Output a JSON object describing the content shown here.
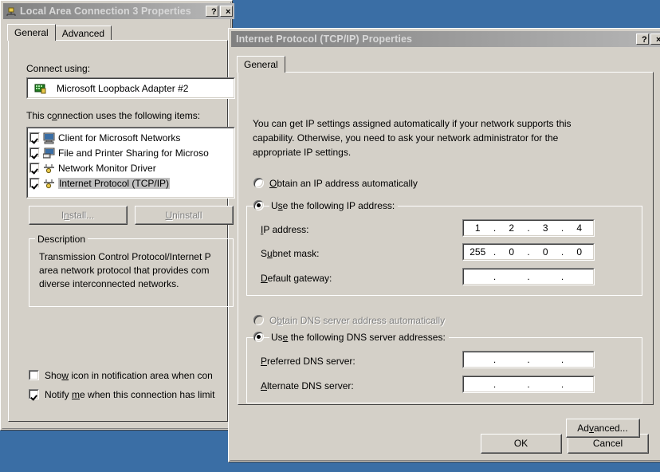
{
  "desktop": {
    "background_color": "#3a6ea5"
  },
  "back_dialog": {
    "title": "Local Area Connection 3 Properties",
    "icon": "network-connection-icon",
    "help_button": "?",
    "close_button": "×",
    "tabs": [
      {
        "label": "General",
        "active": true
      },
      {
        "label": "Advanced",
        "active": false
      }
    ],
    "connect_using_label": "Connect using:",
    "adapter": {
      "name": "Microsoft Loopback Adapter #2",
      "icon": "network-adapter-icon"
    },
    "items_label": "This connection uses the following items:",
    "items": [
      {
        "label": "Client for Microsoft Networks",
        "checked": true,
        "icon": "client-service-icon",
        "selected": false
      },
      {
        "label": "File and Printer Sharing for Microso",
        "checked": true,
        "icon": "file-sharing-icon",
        "selected": false
      },
      {
        "label": "Network Monitor Driver",
        "checked": true,
        "icon": "protocol-icon",
        "selected": false
      },
      {
        "label": "Internet Protocol (TCP/IP)",
        "checked": true,
        "icon": "protocol-icon",
        "selected": true
      }
    ],
    "install_button": "Install...",
    "uninstall_button": "Uninstall",
    "install_enabled": false,
    "uninstall_enabled": false,
    "description_group": "Description",
    "description_lines": [
      "Transmission Control Protocol/Internet P",
      "area network protocol that provides com",
      "diverse interconnected networks."
    ],
    "show_icon_checkbox": {
      "label": "Show icon in notification area when con",
      "checked": false
    },
    "notify_checkbox": {
      "label": "Notify me when this connection has limit",
      "checked": true
    }
  },
  "front_dialog": {
    "title": "Internet Protocol (TCP/IP) Properties",
    "help_button": "?",
    "close_button": "×",
    "tabs": [
      {
        "label": "General",
        "active": true
      }
    ],
    "intro_lines": [
      "You can get IP settings assigned automatically if your network supports this",
      "capability. Otherwise, you need to ask your network administrator for the",
      "appropriate IP settings."
    ],
    "ip_auto_radio": {
      "label": "Obtain an IP address automatically",
      "selected": false,
      "enabled": true
    },
    "ip_manual_radio": {
      "label": "Use the following IP address:",
      "selected": true,
      "enabled": true
    },
    "ip_address": {
      "label": "IP address:",
      "octets": [
        "1",
        "2",
        "3",
        "4"
      ]
    },
    "subnet_mask": {
      "label": "Subnet mask:",
      "octets": [
        "255",
        "0",
        "0",
        "0"
      ]
    },
    "default_gateway": {
      "label": "Default gateway:",
      "octets": [
        "",
        "",
        "",
        ""
      ]
    },
    "dns_auto_radio": {
      "label": "Obtain DNS server address automatically",
      "selected": false,
      "enabled": false
    },
    "dns_manual_radio": {
      "label": "Use the following DNS server addresses:",
      "selected": true,
      "enabled": true
    },
    "preferred_dns": {
      "label": "Preferred DNS server:",
      "octets": [
        "",
        "",
        "",
        ""
      ]
    },
    "alternate_dns": {
      "label": "Alternate DNS server:",
      "octets": [
        "",
        "",
        "",
        ""
      ]
    },
    "advanced_button": "Advanced...",
    "ok_button": "OK",
    "cancel_button": "Cancel"
  }
}
